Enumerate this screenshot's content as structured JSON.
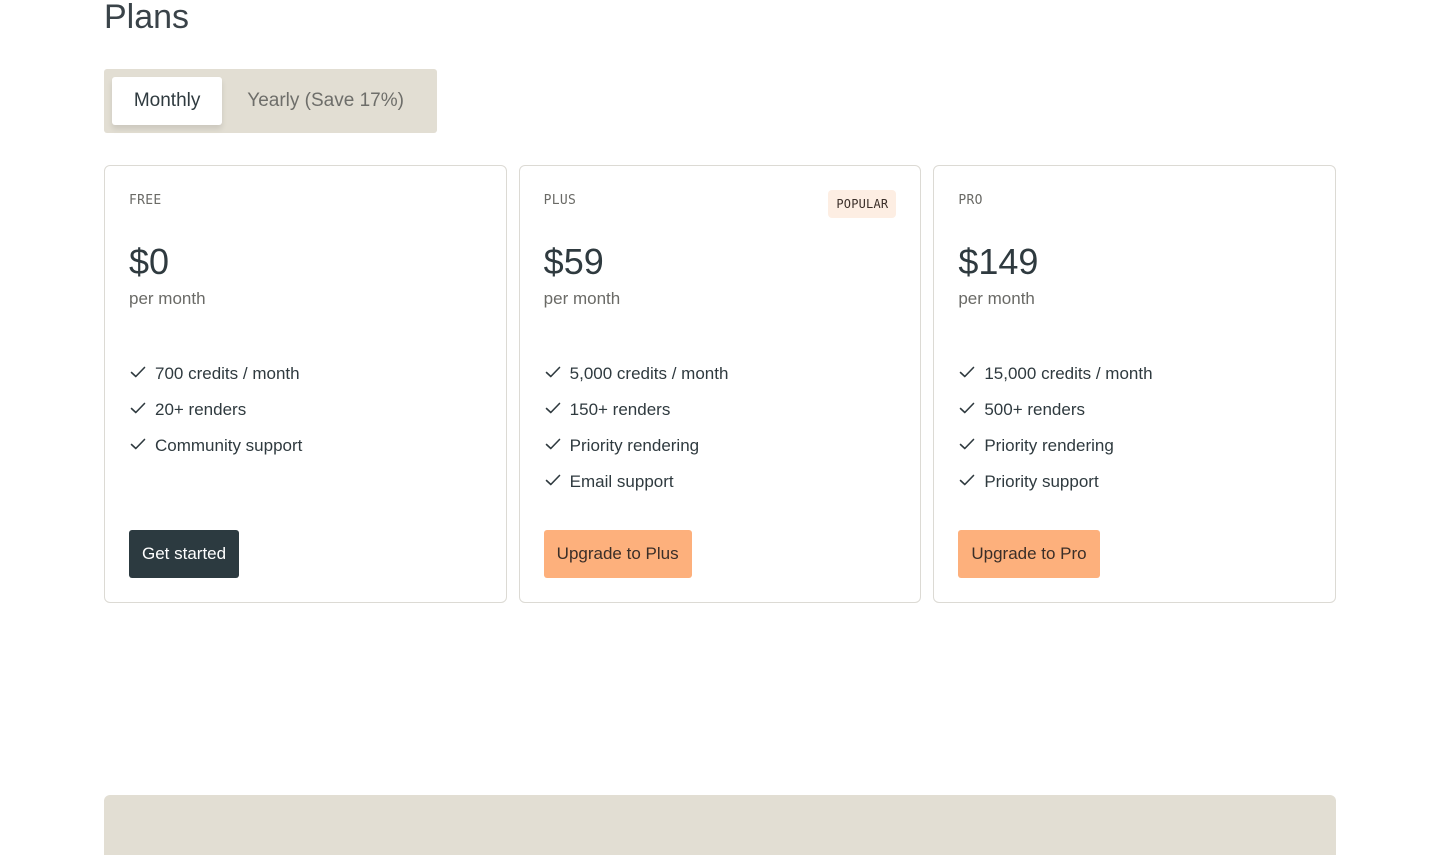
{
  "page": {
    "title": "Plans"
  },
  "billing_toggle": {
    "options": [
      {
        "label": "Monthly",
        "selected": true
      },
      {
        "label": "Yearly (Save 17%)",
        "selected": false
      }
    ]
  },
  "plans": [
    {
      "name": "FREE",
      "price": "$0",
      "period": "per month",
      "badge": "",
      "features": [
        "700 credits / month",
        "20+ renders",
        "Community support"
      ],
      "button_label": "Get started"
    },
    {
      "name": "PLUS",
      "price": "$59",
      "period": "per month",
      "badge": "POPULAR",
      "features": [
        "5,000 credits / month",
        "150+ renders",
        "Priority rendering",
        "Email support"
      ],
      "button_label": "Upgrade to Plus"
    },
    {
      "name": "PRO",
      "price": "$149",
      "period": "per month",
      "badge": "",
      "features": [
        "15,000 credits / month",
        "500+ renders",
        "Priority rendering",
        "Priority support"
      ],
      "button_label": "Upgrade to Pro"
    }
  ],
  "colors": {
    "accent": "#fdb07c",
    "dark_button": "#2c3a40",
    "toggle_background": "#e2ded3",
    "badge_background": "#fdeee3"
  },
  "icons": {
    "feature_check": "check-icon"
  }
}
